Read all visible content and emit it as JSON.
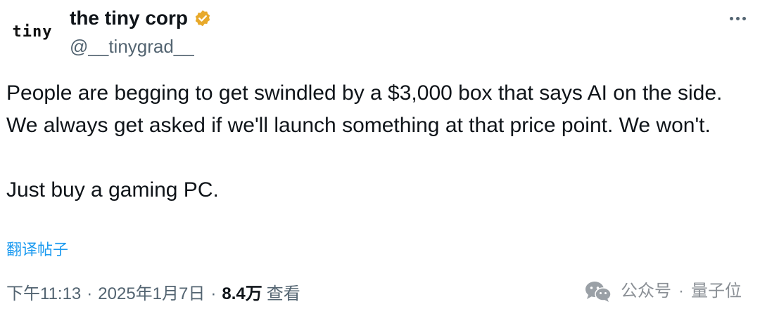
{
  "author": {
    "avatar_text": "tiny",
    "display_name": "the tiny corp",
    "handle": "@__tinygrad__",
    "verified": true,
    "badge_color": "#e8a92a"
  },
  "more_icon": "more-horizontal-icon",
  "tweet": {
    "lines": [
      "People are begging to get swindled by a $3,000 box that says AI on the side. We always get asked if we'll launch something at that price point. We won't.",
      "Just buy a gaming PC."
    ]
  },
  "translate_label": "翻译帖子",
  "meta": {
    "time": "下午11:13",
    "separator": "·",
    "date": "2025年1月7日",
    "views_count": "8.4万",
    "views_label": "查看"
  },
  "watermark": {
    "icon": "wechat-icon",
    "account_label": "公众号",
    "separator": "·",
    "name": "量子位"
  },
  "colors": {
    "text_primary": "#0f1419",
    "text_secondary": "#536471",
    "link": "#1d9bf0"
  }
}
